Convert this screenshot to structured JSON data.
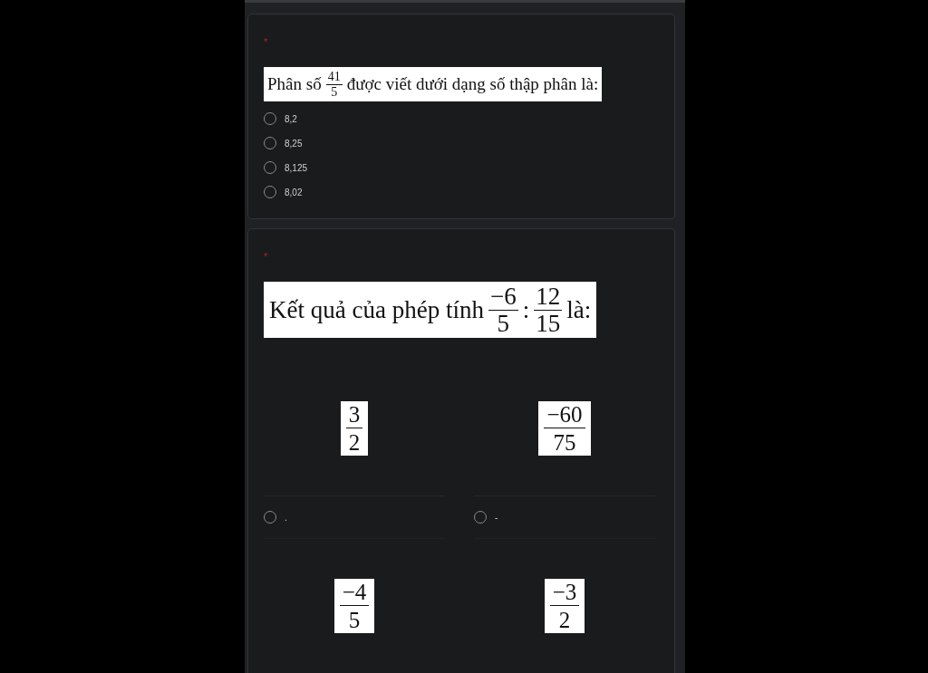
{
  "questions": [
    {
      "required_mark": "*",
      "kind": "list",
      "prompt": [
        {
          "kind": "text",
          "text": "Phân số"
        },
        {
          "kind": "fraction",
          "num": "41",
          "den": "5"
        },
        {
          "kind": "text",
          "text": "được viết dưới dạng số thập phân là:"
        }
      ],
      "options": [
        {
          "label": "8,2",
          "selected": false
        },
        {
          "label": "8,25",
          "selected": false
        },
        {
          "label": "8,125",
          "selected": false
        },
        {
          "label": "8,02",
          "selected": false
        }
      ]
    },
    {
      "required_mark": "*",
      "kind": "grid",
      "prompt": [
        {
          "kind": "text",
          "text": "Kết quả của phép tính"
        },
        {
          "kind": "fraction",
          "num": "−6",
          "den": "5"
        },
        {
          "kind": "sign",
          "text": ":"
        },
        {
          "kind": "fraction",
          "num": "12",
          "den": "15"
        },
        {
          "kind": "text",
          "text": "là:"
        }
      ],
      "options": [
        {
          "image": {
            "num": "3",
            "den": "2"
          },
          "label": ".",
          "selected": false
        },
        {
          "image": {
            "num": "−60",
            "den": "75"
          },
          "label": "-",
          "selected": false
        },
        {
          "image": {
            "num": "−4",
            "den": "5"
          }
        },
        {
          "image": {
            "num": "−3",
            "den": "2"
          }
        }
      ]
    }
  ]
}
